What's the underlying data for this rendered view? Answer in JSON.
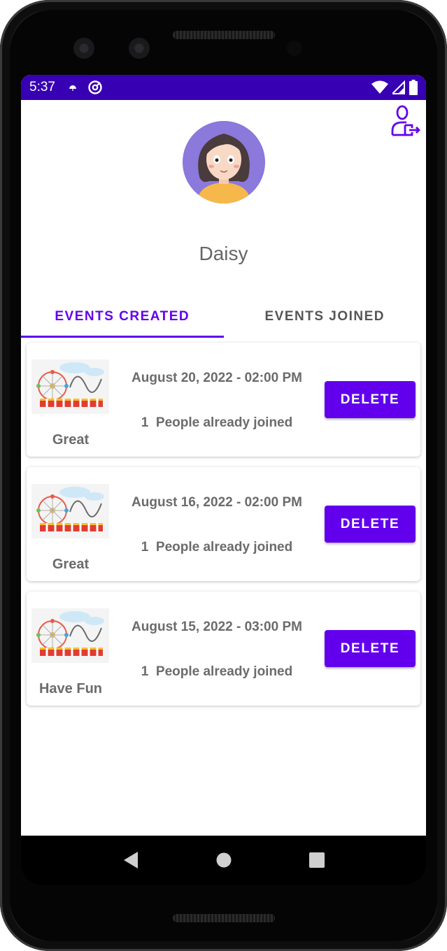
{
  "status_bar": {
    "time": "5:37",
    "icons": [
      "weather-icon",
      "at-sign-icon",
      "wifi-icon",
      "signal-icon",
      "battery-icon"
    ]
  },
  "profile": {
    "username": "Daisy",
    "avatar": "avatar",
    "logout_icon": "user-logout-icon"
  },
  "tabs": [
    {
      "label": "EVENTS CREATED",
      "active": true
    },
    {
      "label": "EVENTS JOINED",
      "active": false
    }
  ],
  "events": [
    {
      "name": "Great",
      "date": "August 20, 2022 - 02:00 PM",
      "joined_count": "1",
      "joined_text": "People already joined",
      "action": "DELETE"
    },
    {
      "name": "Great",
      "date": "August 16, 2022 - 02:00 PM",
      "joined_count": "1",
      "joined_text": "People already joined",
      "action": "DELETE"
    },
    {
      "name": "Have Fun",
      "date": "August 15, 2022 - 03:00 PM",
      "joined_count": "1",
      "joined_text": "People already joined",
      "action": "DELETE"
    }
  ],
  "colors": {
    "primary": "#6200ee",
    "status_bar": "#3700b3",
    "text": "#6b6b6b"
  },
  "navigation": [
    "back-icon",
    "home-icon",
    "recents-icon"
  ]
}
